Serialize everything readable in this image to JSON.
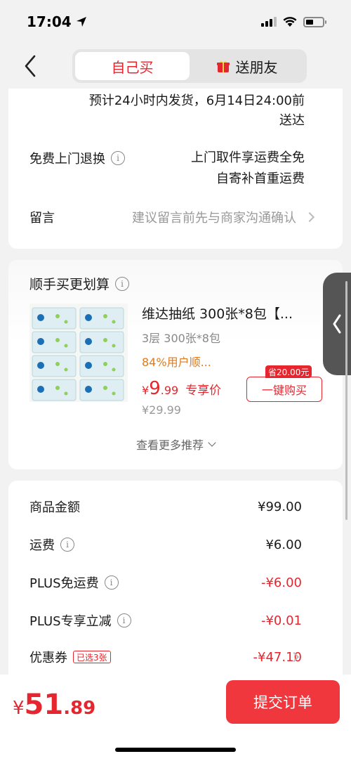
{
  "status_bar": {
    "time": "17:04"
  },
  "nav": {
    "tab_self": "自己买",
    "tab_gift": "送朋友"
  },
  "delivery": {
    "line1": "预计24小时内发货，6月14日24:00前",
    "line2": "送达"
  },
  "returns": {
    "label": "免费上门退换",
    "value_line1": "上门取件享运费全免",
    "value_line2": "自寄补首重运费"
  },
  "message": {
    "label": "留言",
    "placeholder": "建议留言前先与商家沟通确认"
  },
  "addon": {
    "title": "顺手买更划算",
    "product": {
      "title": "维达抽纸 300张*8包【...",
      "spec": "3层 300张*8包",
      "rating": "84%用户顺...",
      "price_symbol": "¥",
      "price_int": "9",
      "price_dec": ".99",
      "price_tag": "专享价",
      "original_price": "¥29.99",
      "save_badge": "省20.00元",
      "buy_button": "一键购买"
    },
    "more": "查看更多推荐"
  },
  "summary": {
    "rows": [
      {
        "label": "商品金额",
        "value": "¥99.00"
      },
      {
        "label": "运费",
        "value": "¥6.00"
      },
      {
        "label": "PLUS免运费",
        "value": "-¥6.00"
      },
      {
        "label": "PLUS专享立减",
        "value": "-¥0.01"
      },
      {
        "label": "优惠券",
        "tag": "已选3张",
        "value": "-¥47.10"
      }
    ]
  },
  "bottom": {
    "total_symbol": "¥",
    "total_int": "51",
    "total_dec": ".89",
    "submit": "提交订单"
  },
  "colors": {
    "accent": "#e6262e",
    "orange": "#e07a1f"
  }
}
